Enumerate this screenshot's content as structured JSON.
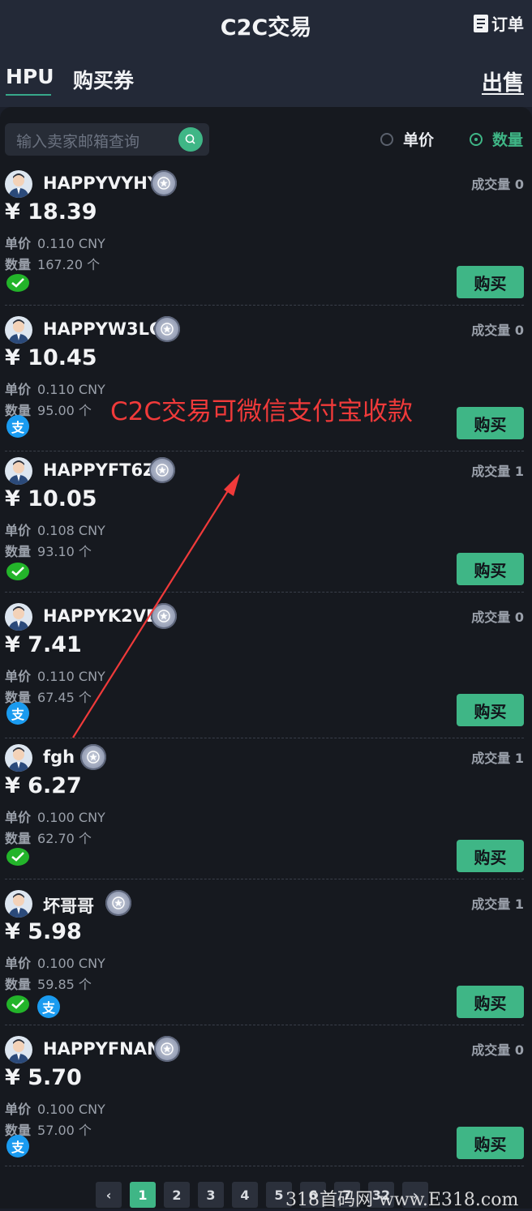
{
  "header": {
    "title": "C2C交易",
    "orders_label": "订单"
  },
  "tabs": [
    {
      "label": "HPU",
      "active": true
    },
    {
      "label": "购买券",
      "active": false
    }
  ],
  "sell_label": "出售",
  "search": {
    "placeholder": "输入卖家邮箱查询"
  },
  "sort": {
    "unit_price_label": "单价",
    "quantity_label": "数量",
    "selected": "数量"
  },
  "listings": [
    {
      "name": "HAPPYVYHY",
      "deals": "成交量 0",
      "price": "¥ 18.39",
      "unit_label": "单价",
      "unit_value": "0.110 CNY",
      "qty_label": "数量",
      "qty_value": "167.20 个",
      "pay": [
        "wechat"
      ],
      "buy_label": "购买"
    },
    {
      "name": "HAPPYW3LC",
      "deals": "成交量 0",
      "price": "¥ 10.45",
      "unit_label": "单价",
      "unit_value": "0.110 CNY",
      "qty_label": "数量",
      "qty_value": "95.00 个",
      "pay": [
        "alipay"
      ],
      "buy_label": "购买"
    },
    {
      "name": "HAPPYFT6Z",
      "deals": "成交量 1",
      "price": "¥ 10.05",
      "unit_label": "单价",
      "unit_value": "0.108 CNY",
      "qty_label": "数量",
      "qty_value": "93.10 个",
      "pay": [
        "wechat"
      ],
      "buy_label": "购买"
    },
    {
      "name": "HAPPYK2VE",
      "deals": "成交量 0",
      "price": "¥ 7.41",
      "unit_label": "单价",
      "unit_value": "0.110 CNY",
      "qty_label": "数量",
      "qty_value": "67.45 个",
      "pay": [
        "alipay"
      ],
      "buy_label": "购买"
    },
    {
      "name": "fgh",
      "deals": "成交量 1",
      "price": "¥ 6.27",
      "unit_label": "单价",
      "unit_value": "0.100 CNY",
      "qty_label": "数量",
      "qty_value": "62.70 个",
      "pay": [
        "wechat"
      ],
      "buy_label": "购买"
    },
    {
      "name": "坏哥哥",
      "deals": "成交量 1",
      "price": "¥ 5.98",
      "unit_label": "单价",
      "unit_value": "0.100 CNY",
      "qty_label": "数量",
      "qty_value": "59.85 个",
      "pay": [
        "wechat",
        "alipay"
      ],
      "buy_label": "购买"
    },
    {
      "name": "HAPPYFNAN",
      "deals": "成交量 0",
      "price": "¥ 5.70",
      "unit_label": "单价",
      "unit_value": "0.100 CNY",
      "qty_label": "数量",
      "qty_value": "57.00 个",
      "pay": [
        "alipay"
      ],
      "buy_label": "购买"
    }
  ],
  "alipay_glyph": "支",
  "annotation": "C2C交易可微信支付宝收款",
  "pagination": {
    "prev": "‹",
    "pages": [
      "1",
      "2",
      "3",
      "4",
      "5",
      "6",
      "7",
      "32"
    ],
    "current": "1",
    "next": "›"
  },
  "watermark": "318首码网 www.E318.com",
  "colors": {
    "accent": "#3fb686",
    "wechat": "#23b42a",
    "alipay": "#1a9bf0",
    "annotation": "#f03a3a",
    "background": "#16191f"
  }
}
